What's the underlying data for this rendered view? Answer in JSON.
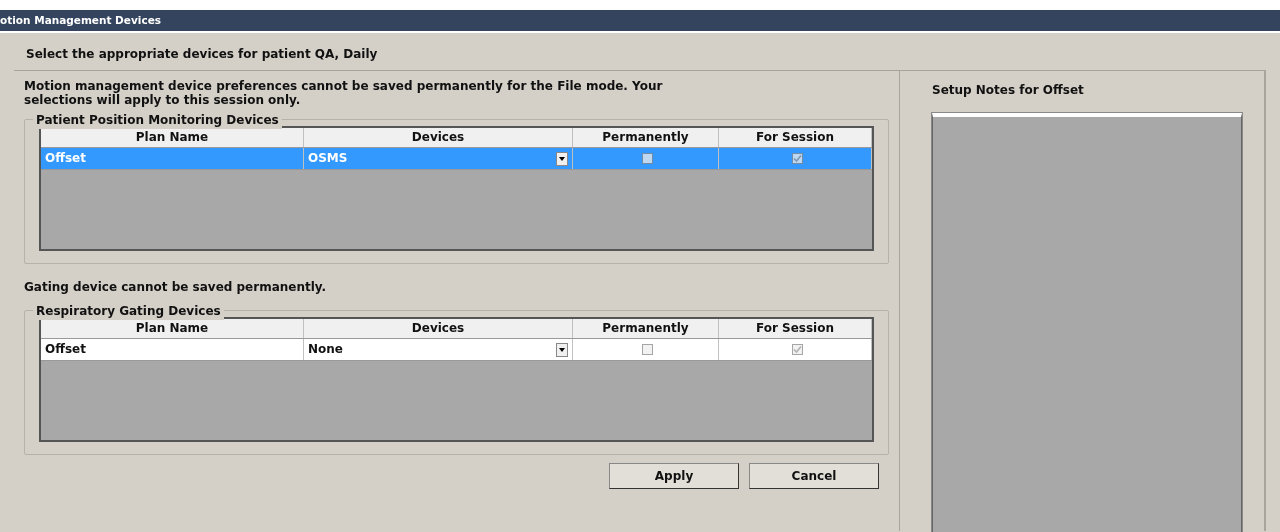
{
  "window": {
    "title": "otion Management Devices"
  },
  "instruction": "Select the appropriate devices for patient QA, Daily",
  "notice": "Motion management device preferences cannot be saved permanently for the File mode. Your selections will apply to this session only.",
  "groups": [
    {
      "title": "Patient Position Monitoring Devices",
      "columns": [
        "Plan Name",
        "Devices",
        "Permanently",
        "For Session"
      ],
      "rows": [
        {
          "plan_name": "Offset",
          "device": "OSMS",
          "selected": true,
          "permanently": {
            "checked": false,
            "disabled": true
          },
          "for_session": {
            "checked": true,
            "disabled": true
          }
        }
      ]
    },
    {
      "note": "Gating device cannot be saved permanently.",
      "title": "Respiratory Gating Devices",
      "columns": [
        "Plan Name",
        "Devices",
        "Permanently",
        "For Session"
      ],
      "rows": [
        {
          "plan_name": "Offset",
          "device": "None",
          "selected": false,
          "permanently": {
            "checked": false,
            "disabled": true
          },
          "for_session": {
            "checked": true,
            "disabled": true
          }
        }
      ]
    }
  ],
  "buttons": [
    "Apply",
    "Cancel"
  ],
  "setup_notes": {
    "title": "Setup Notes for Offset"
  }
}
